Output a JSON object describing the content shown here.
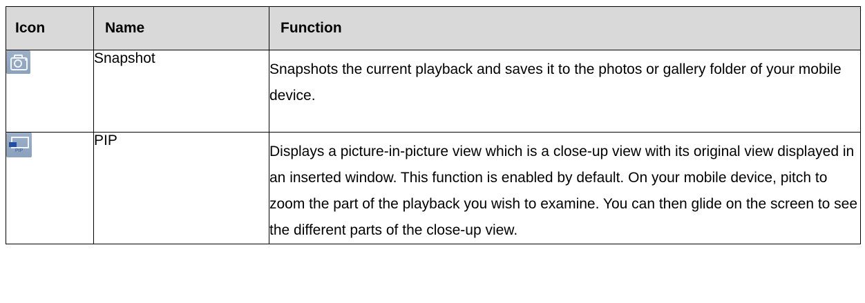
{
  "table": {
    "headers": {
      "icon": "Icon",
      "name": "Name",
      "function": "Function"
    },
    "rows": [
      {
        "icon": "camera-icon",
        "name": "Snapshot",
        "function": "Snapshots the current playback and saves it to the photos or gallery folder of your mobile device."
      },
      {
        "icon": "pip-icon",
        "icon_text": "PIP",
        "name": "PIP",
        "function": "Displays a picture-in-picture view which is a close-up view with its original view displayed in an inserted window. This function is enabled by default. On your mobile device, pitch to zoom the part of the playback you wish to examine. You can then glide on the screen to see the different parts of the close-up view."
      }
    ]
  },
  "colors": {
    "header_bg": "#d9d9d9",
    "icon_bg": "#94a9c3",
    "pip_accent": "#1f4fa8"
  }
}
